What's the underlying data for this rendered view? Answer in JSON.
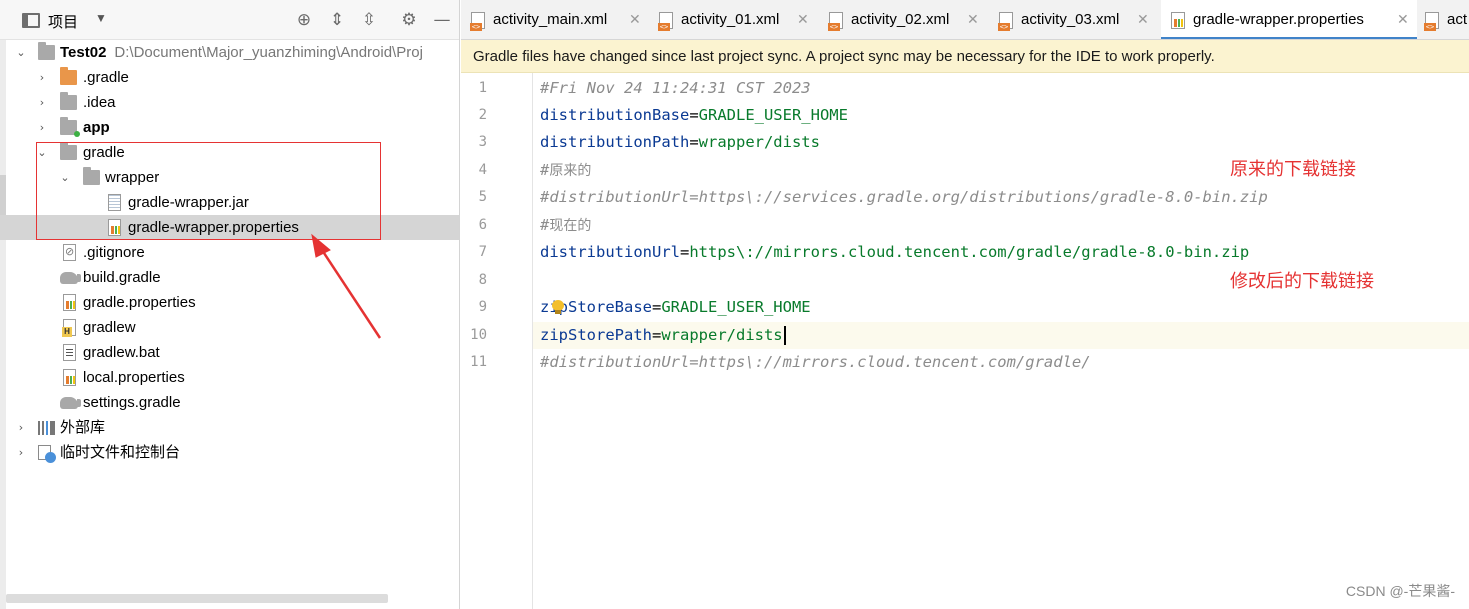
{
  "project_panel": {
    "title": "项目",
    "header_buttons": [
      "target-icon",
      "expand-all-icon",
      "collapse-all-icon",
      "gear-icon",
      "minimize-icon"
    ],
    "tree": [
      {
        "label": "Test02",
        "path": "D:\\Document\\Major_yuanzhiming\\Android\\Proj",
        "arrow": "open",
        "icon": "module-folder"
      },
      {
        "label": ".gradle",
        "arrow": "closed",
        "icon": "folder-orange"
      },
      {
        "label": ".idea",
        "arrow": "closed",
        "icon": "folder"
      },
      {
        "label": "app",
        "arrow": "closed",
        "icon": "module-folder"
      },
      {
        "label": "gradle",
        "arrow": "open",
        "icon": "folder"
      },
      {
        "label": "wrapper",
        "arrow": "open",
        "icon": "folder"
      },
      {
        "label": "gradle-wrapper.jar",
        "icon": "jar-file"
      },
      {
        "label": "gradle-wrapper.properties",
        "icon": "properties-file",
        "selected": true
      },
      {
        "label": ".gitignore",
        "icon": "ignore-file"
      },
      {
        "label": "build.gradle",
        "icon": "gradle-file"
      },
      {
        "label": "gradle.properties",
        "icon": "properties-file"
      },
      {
        "label": "gradlew",
        "icon": "shell-file"
      },
      {
        "label": "gradlew.bat",
        "icon": "bat-file"
      },
      {
        "label": "local.properties",
        "icon": "properties-file"
      },
      {
        "label": "settings.gradle",
        "icon": "gradle-file"
      },
      {
        "label": "外部库",
        "arrow": "closed",
        "icon": "library"
      },
      {
        "label": "临时文件和控制台",
        "arrow": "closed",
        "icon": "scratch"
      }
    ]
  },
  "editor": {
    "tabs": [
      {
        "label": "activity_main.xml",
        "icon": "xml-file"
      },
      {
        "label": "activity_01.xml",
        "icon": "xml-file"
      },
      {
        "label": "activity_02.xml",
        "icon": "xml-file"
      },
      {
        "label": "activity_03.xml",
        "icon": "xml-file"
      },
      {
        "label": "gradle-wrapper.properties",
        "icon": "properties-file",
        "active": true
      },
      {
        "label": "act",
        "icon": "xml-file"
      }
    ],
    "banner": "Gradle files have changed since last project sync. A project sync may be necessary for the IDE to work properly.",
    "current_line": 10,
    "lines": [
      {
        "n": "1",
        "comment": "#Fri Nov 24 11:24:31 CST 2023"
      },
      {
        "n": "2",
        "key": "distributionBase",
        "eq": "=",
        "value": "GRADLE_USER_HOME"
      },
      {
        "n": "3",
        "key": "distributionPath",
        "eq": "=",
        "value": "wrapper/dists"
      },
      {
        "n": "4",
        "hash": "#",
        "comment_cn": "原来的"
      },
      {
        "n": "5",
        "comment": "#distributionUrl=https\\://services.gradle.org/distributions/gradle-8.0-bin.zip"
      },
      {
        "n": "6",
        "hash": "#",
        "comment_cn": "现在的"
      },
      {
        "n": "7",
        "key": "distributionUrl",
        "eq": "=",
        "value": "https\\://mirrors.cloud.tencent.com/gradle/gradle-8.0-bin.zip"
      },
      {
        "n": "8"
      },
      {
        "n": "9",
        "key": "zipStoreBase",
        "eq": "=",
        "value": "GRADLE_USER_HOME"
      },
      {
        "n": "10",
        "key": "zipStorePath",
        "eq": "=",
        "value": "wrapper/dists"
      },
      {
        "n": "11",
        "comment": "#distributionUrl=https\\://mirrors.cloud.tencent.com/gradle/"
      }
    ]
  },
  "annotations": {
    "original_link": "原来的下载链接",
    "modified_link": "修改后的下载链接",
    "color": "#e53333"
  },
  "watermark": "CSDN @-芒果酱-"
}
